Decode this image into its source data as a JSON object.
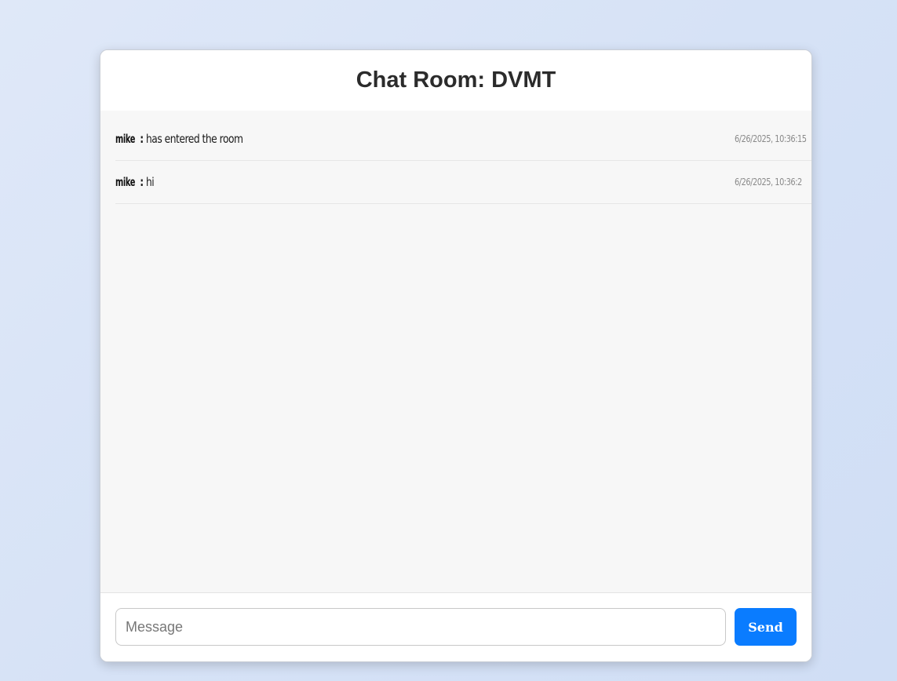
{
  "header": {
    "title": "Chat Room: DVMT"
  },
  "messages": [
    {
      "user": "mike",
      "separator": ":",
      "text": "has entered the room",
      "time": "6/26/2025, 10:36:15"
    },
    {
      "user": "mike",
      "separator": ":",
      "text": "hi",
      "time": "6/26/2025, 10:36:2"
    }
  ],
  "composer": {
    "placeholder": "Message",
    "value": "",
    "send_label": "Send"
  },
  "colors": {
    "accent": "#0a7cff",
    "background": "#dae5f7"
  }
}
